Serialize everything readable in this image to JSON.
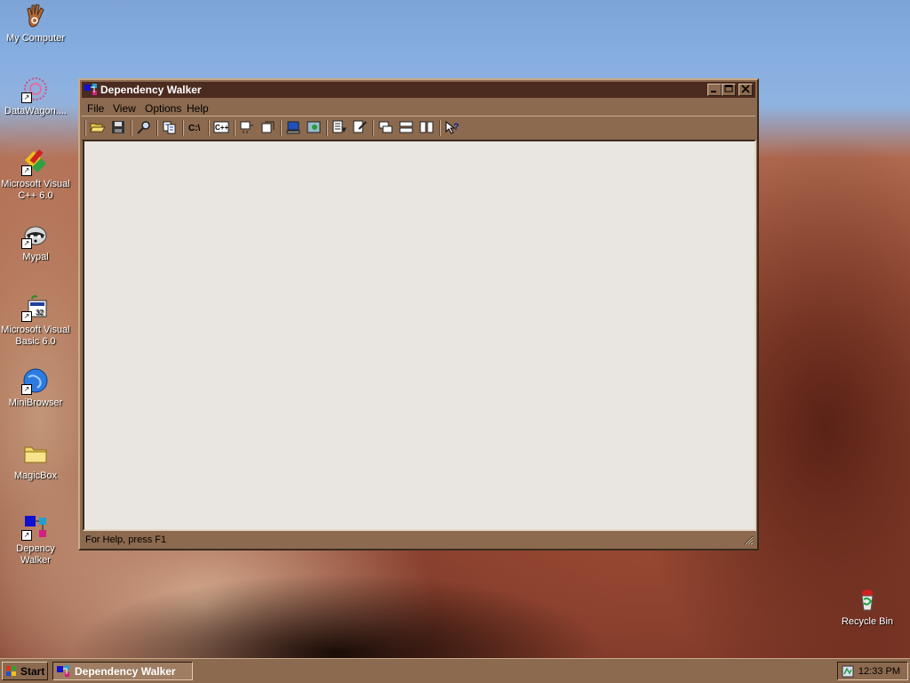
{
  "desktop": {
    "icons": [
      {
        "label": "My Computer"
      },
      {
        "label": "DataWagon...."
      },
      {
        "label": "Microsoft Visual C++ 6.0"
      },
      {
        "label": "Mypal"
      },
      {
        "label": "Microsoft Visual Basic 6.0"
      },
      {
        "label": "MiniBrowser"
      },
      {
        "label": "MagicBox"
      },
      {
        "label": "Depency Walker"
      },
      {
        "label": "Recycle Bin"
      }
    ]
  },
  "window": {
    "title": "Dependency Walker",
    "menu": [
      "File",
      "View",
      "Options",
      "Help"
    ],
    "toolbar_icons": [
      "open-icon",
      "save-icon",
      "find-icon",
      "copy-icon",
      "full-paths-icon",
      "undecorate-cpp-icon",
      "auto-expand-icon",
      "collapse-icon",
      "system-info-icon",
      "configure-module-search-icon",
      "view-module-icon",
      "external-viewer-icon",
      "cascade-icon",
      "tile-horizontal-icon",
      "tile-vertical-icon",
      "context-help-icon"
    ],
    "status_text": "For Help, press F1"
  },
  "taskbar": {
    "start_label": "Start",
    "task_label": "Dependency Walker",
    "clock": "12:33 PM"
  },
  "colors": {
    "frame": "#8c6a4f",
    "titlebar": "#4b2a20",
    "client": "#e9e6e1"
  }
}
